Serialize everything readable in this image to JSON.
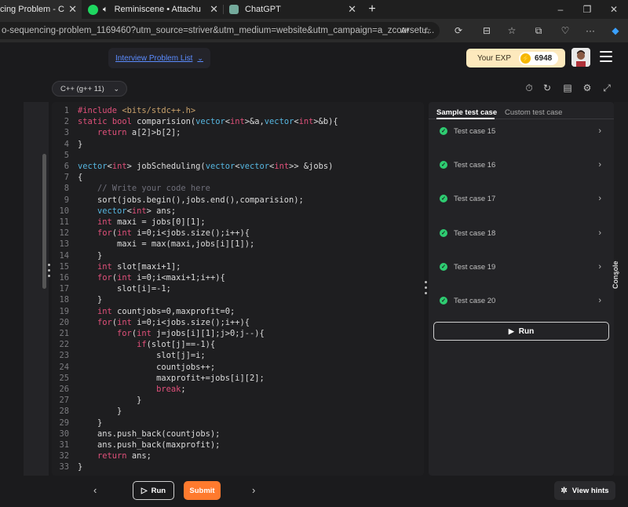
{
  "browser": {
    "tabs": [
      {
        "title": "cing Problem - Codin",
        "active": true
      },
      {
        "title": "Reminiscene • Attachu",
        "active": false
      },
      {
        "title": "ChatGPT",
        "active": false
      }
    ],
    "new_tab": "+",
    "window_controls": [
      "–",
      "❐",
      "✕"
    ],
    "url": "o-sequencing-problem_1169460?utm_source=striver&utm_medium=website&utm_campaign=a_zcoursetu..."
  },
  "header": {
    "interview_list": "Interview Problem List",
    "exp_label": "Your EXP",
    "exp_value": "6948"
  },
  "toolbar": {
    "language": "C++ (g++ 11)"
  },
  "code": [
    "#include <bits/stdc++.h>",
    "static bool comparision(vector<int>&a,vector<int>&b){",
    "    return a[2]>b[2];",
    "}",
    "",
    "vector<int> jobScheduling(vector<vector<int>> &jobs)",
    "{",
    "    // Write your code here",
    "    sort(jobs.begin(),jobs.end(),comparision);",
    "    vector<int> ans;",
    "    int maxi = jobs[0][1];",
    "    for(int i=0;i<jobs.size();i++){",
    "        maxi = max(maxi,jobs[i][1]);",
    "    }",
    "    int slot[maxi+1];",
    "    for(int i=0;i<maxi+1;i++){",
    "        slot[i]=-1;",
    "    }",
    "    int countjobs=0,maxprofit=0;",
    "    for(int i=0;i<jobs.size();i++){",
    "        for(int j=jobs[i][1];j>0;j--){",
    "            if(slot[j]==-1){",
    "                slot[j]=i;",
    "                countjobs++;",
    "                maxprofit+=jobs[i][2];",
    "                break;",
    "            }",
    "        }",
    "    }",
    "    ans.push_back(countjobs);",
    "    ans.push_back(maxprofit);",
    "    return ans;",
    "}"
  ],
  "right_panel": {
    "tabs": [
      "Sample test case",
      "Custom test case"
    ],
    "test_cases": [
      "Test case 15",
      "Test case 16",
      "Test case 17",
      "Test case 18",
      "Test case 19",
      "Test case 20"
    ],
    "run_label": "Run",
    "console_label": "Console"
  },
  "bottom": {
    "run_label": "Run",
    "submit_label": "Submit",
    "hints_label": "View hints"
  }
}
